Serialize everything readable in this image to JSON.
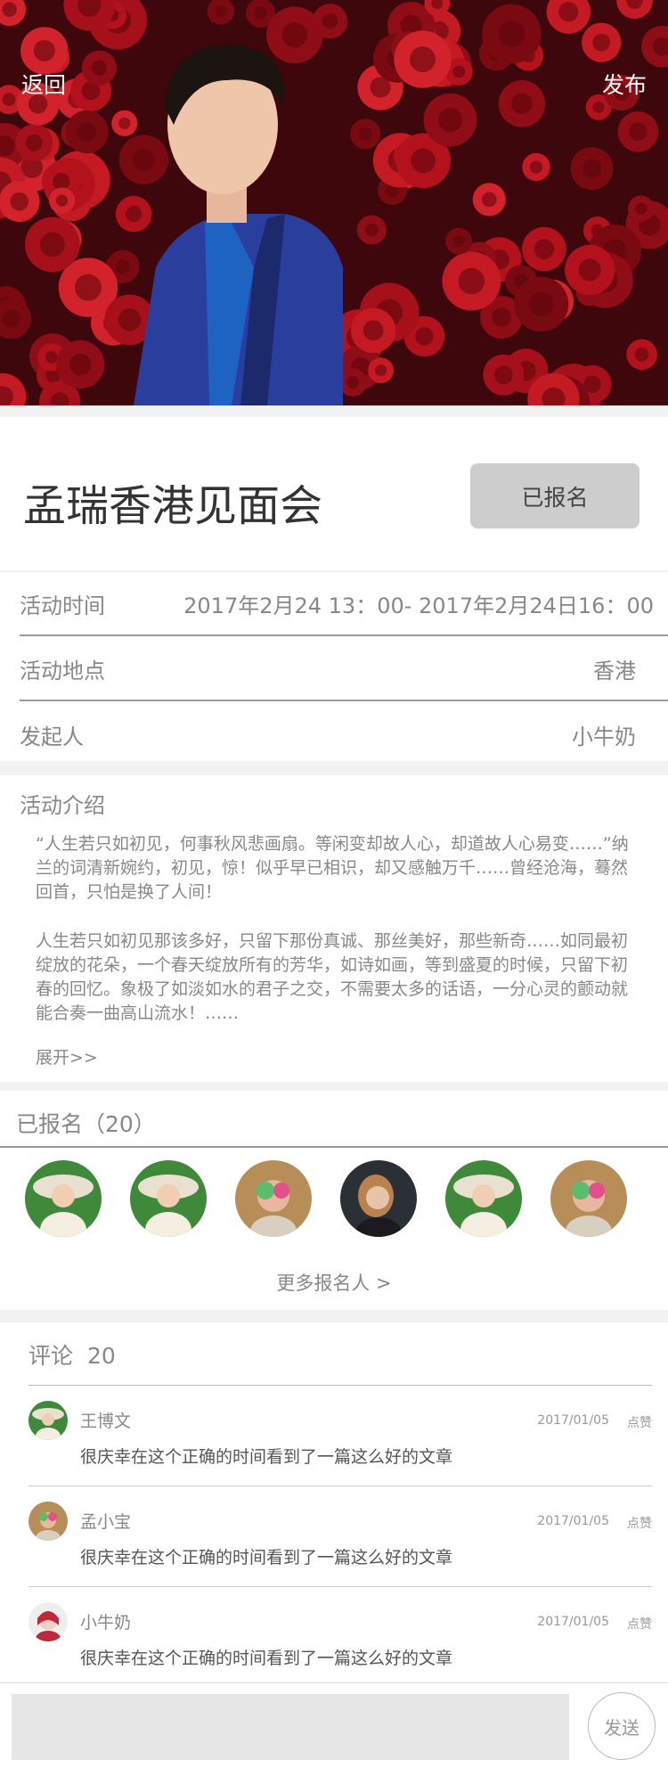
{
  "nav": {
    "back_label": "返回",
    "publish_label": "发布"
  },
  "event": {
    "title": "孟瑞香港见面会",
    "signup_status_label": "已报名",
    "info": [
      {
        "label": "活动时间",
        "value": "2017年2月24 13：00- 2017年2月24日16：00"
      },
      {
        "label": "活动地点",
        "value": "香港"
      },
      {
        "label": "发起人",
        "value": "小牛奶"
      }
    ]
  },
  "intro": {
    "heading": "活动介绍",
    "paragraphs": [
      "“人生若只如初见，何事秋风悲画扇。等闲变却故人心，却道故人心易变……”纳兰的词清新婉约，初见，惊！似乎早已相识，却又感触万千……曾经沧海，蓦然回首，只怕是换了人间！",
      "人生若只如初见那该多好，只留下那份真诚、那丝美好，那些新奇……如同最初绽放的花朵，一个春天绽放所有的芳华，如诗如画，等到盛夏的时候，只留下初春的回忆。象极了如淡如水的君子之交，不需要太多的话语，一分心灵的颤动就能合奏一曲高山流水！……"
    ],
    "expand_label": "展开>>"
  },
  "signed_up": {
    "heading": "已报名（20）",
    "more_label": "更多报名人 >"
  },
  "comments": {
    "heading": "评论",
    "count": "20",
    "items": [
      {
        "name": "王博文",
        "date": "2017/01/05",
        "like_label": "点赞",
        "text": "很庆幸在这个正确的时间看到了一篇这么好的文章"
      },
      {
        "name": "孟小宝",
        "date": "2017/01/05",
        "like_label": "点赞",
        "text": "很庆幸在这个正确的时间看到了一篇这么好的文章"
      },
      {
        "name": "小牛奶",
        "date": "2017/01/05",
        "like_label": "点赞",
        "text": "很庆幸在这个正确的时间看到了一篇这么好的文章"
      }
    ]
  },
  "bottom_bar": {
    "input_placeholder": "",
    "send_label": "发送"
  },
  "colors": {
    "hero_bg": "#4a0a0f",
    "rose": "#b3121d",
    "button_gray": "#cdcdcd",
    "divider": "#999999"
  }
}
